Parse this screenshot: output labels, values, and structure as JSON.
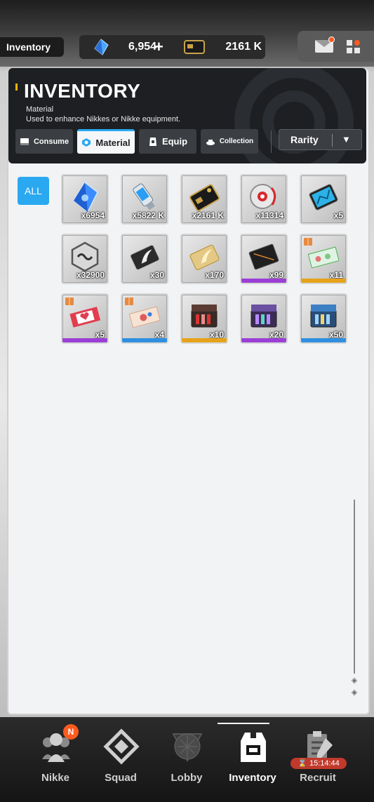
{
  "top_bar": {
    "breadcrumb": "Inventory",
    "gems": "6,954",
    "plus": "+",
    "credits": "2161 K"
  },
  "header": {
    "title": "INVENTORY",
    "subtitle": "Material",
    "description": "Used to enhance Nikkes or Nikke equipment."
  },
  "tabs": [
    {
      "label": "Consume",
      "icon": "consume-icon"
    },
    {
      "label": "Material",
      "icon": "material-icon",
      "active": true
    },
    {
      "label": "Equip",
      "icon": "equip-icon"
    },
    {
      "label": "Collection",
      "icon": "collection-icon"
    }
  ],
  "sort": {
    "label": "Rarity",
    "arrow": "▼"
  },
  "filter": {
    "label": "ALL"
  },
  "items": [
    {
      "name": "gem-item",
      "qty": "x6954",
      "rarity": "none"
    },
    {
      "name": "usb-item",
      "qty": "x5822 K",
      "rarity": "none"
    },
    {
      "name": "credit-card-item",
      "qty": "x2161 K",
      "rarity": "none"
    },
    {
      "name": "core-orb-item",
      "qty": "x11314",
      "rarity": "none"
    },
    {
      "name": "tablet-item",
      "qty": "x5",
      "rarity": "none"
    },
    {
      "name": "hex-module-item",
      "qty": "x32900",
      "rarity": "none"
    },
    {
      "name": "wing-card-item",
      "qty": "x30",
      "rarity": "none"
    },
    {
      "name": "gold-card-item",
      "qty": "x170",
      "rarity": "none"
    },
    {
      "name": "black-case-item",
      "qty": "x99",
      "rarity": "purple"
    },
    {
      "name": "green-ticket-item",
      "qty": "x11",
      "rarity": "gold"
    },
    {
      "name": "red-ticket-item",
      "qty": "x5",
      "rarity": "purple"
    },
    {
      "name": "cream-ticket-item",
      "qty": "x4",
      "rarity": "blue"
    },
    {
      "name": "red-toolbox-item",
      "qty": "x10",
      "rarity": "gold"
    },
    {
      "name": "purple-toolbox-item",
      "qty": "x20",
      "rarity": "purple"
    },
    {
      "name": "blue-toolbox-item",
      "qty": "x50",
      "rarity": "blue"
    }
  ],
  "bottom_nav": [
    {
      "label": "Nikke"
    },
    {
      "label": "Squad"
    },
    {
      "label": "Lobby"
    },
    {
      "label": "Inventory",
      "active": true
    },
    {
      "label": "Recruit"
    }
  ],
  "nikke_badge": "N",
  "recruit_timer": "15:14:44",
  "colors": {
    "accent": "#2aa8f0",
    "rarity_purple": "#9b3fd6",
    "rarity_gold": "#e6a21a",
    "rarity_blue": "#2f8fe0",
    "notify": "#ff5a1f"
  }
}
